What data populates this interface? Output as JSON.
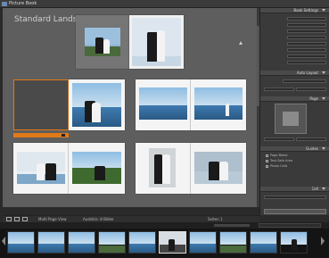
{
  "app": {
    "title": "Picture Book"
  },
  "layout_overlay": {
    "line1": "Standard Landscape",
    "line2": "",
    "line3": ""
  },
  "cover_caption": "",
  "right_panel": {
    "sections": [
      {
        "name": "Book Settings"
      },
      {
        "name": "Auto Layout"
      },
      {
        "name": "Page"
      },
      {
        "name": "Guides"
      },
      {
        "name": "Cell"
      }
    ],
    "checkbox_rows": [
      "Page Bleed",
      "Text Safe Area",
      "Photo Cells"
    ]
  },
  "toolbar": {
    "left_label": "Multi Page View",
    "middle_label": "Ausblick: 8 Bilder",
    "page_info": "Seiten 1"
  },
  "filmstrip": {
    "count": 10,
    "selected_index": 5
  },
  "colors": {
    "accent": "#e07a18",
    "canvas": "#5e5e5e",
    "panel": "#3a3a3a"
  }
}
